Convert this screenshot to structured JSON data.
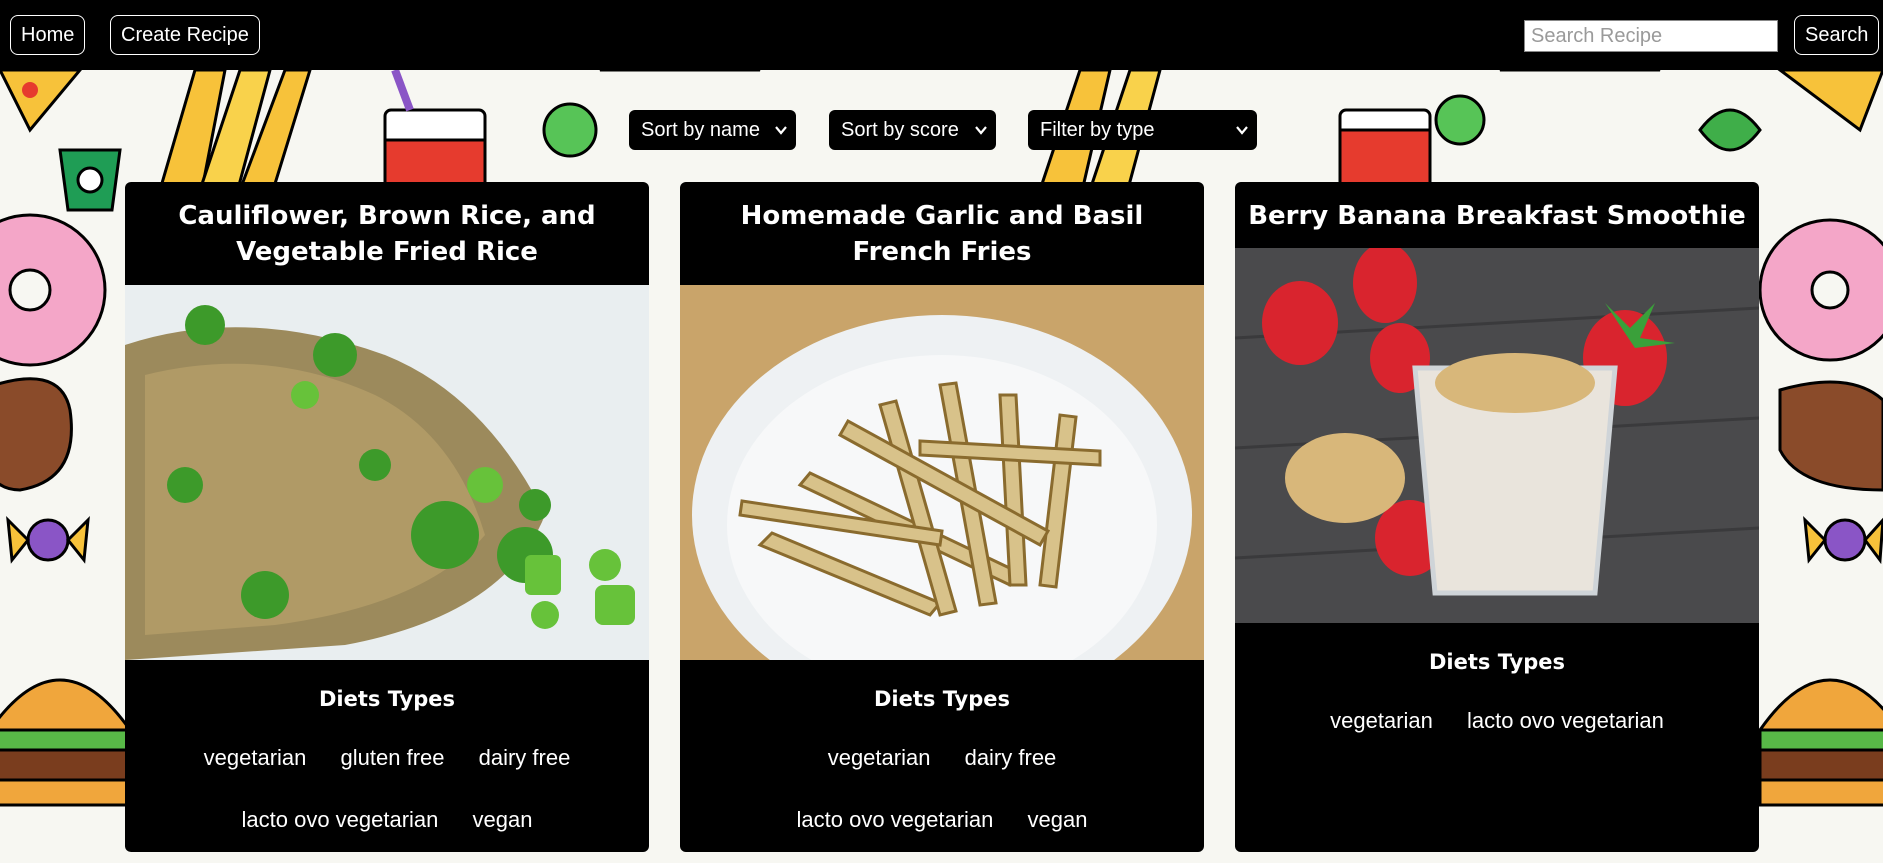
{
  "nav": {
    "home_label": "Home",
    "create_label": "Create Recipe",
    "search_placeholder": "Search Recipe",
    "search_label": "Search"
  },
  "controls": {
    "sort_name": "Sort by name",
    "sort_score": "Sort by score",
    "filter_type": "Filter by type"
  },
  "colors": {
    "bar": "#000000",
    "text": "#ffffff",
    "background": "#f7f7f2"
  },
  "recipes": [
    {
      "title": "Cauliflower, Brown Rice, and Vegetable Fried Rice",
      "diets_heading": "Diets Types",
      "diets": [
        "vegetarian",
        "gluten free",
        "dairy free",
        "lacto ovo vegetarian",
        "vegan"
      ],
      "image": "fried-rice-photo"
    },
    {
      "title": "Homemade Garlic and Basil French Fries",
      "diets_heading": "Diets Types",
      "diets": [
        "vegetarian",
        "dairy free",
        "lacto ovo vegetarian",
        "vegan"
      ],
      "image": "french-fries-photo"
    },
    {
      "title": "Berry Banana Breakfast Smoothie",
      "diets_heading": "Diets Types",
      "diets": [
        "vegetarian",
        "lacto ovo vegetarian"
      ],
      "image": "smoothie-photo"
    }
  ]
}
